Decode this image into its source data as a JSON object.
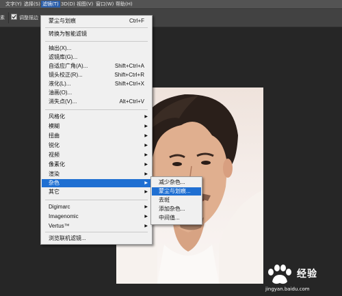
{
  "menubar": {
    "items": [
      {
        "label": "文字(Y)"
      },
      {
        "label": "选择(S)"
      },
      {
        "label": "滤镜(T)"
      },
      {
        "label": "3D(D)"
      },
      {
        "label": "视图(V)"
      },
      {
        "label": "窗口(W)"
      },
      {
        "label": "帮助(H)"
      }
    ]
  },
  "options_bar": {
    "left_fragment": "素",
    "checkbox_label": "调整描边",
    "checked": true
  },
  "filter_menu": {
    "items": [
      {
        "label": "蒙尘与划痕",
        "shortcut": "Ctrl+F"
      },
      {
        "label": "转换为智能滤镜"
      },
      {
        "label": "抽出(X)..."
      },
      {
        "label": "滤镜库(G)..."
      },
      {
        "label": "自适应广角(A)...",
        "shortcut": "Shift+Ctrl+A"
      },
      {
        "label": "镜头校正(R)...",
        "shortcut": "Shift+Ctrl+R"
      },
      {
        "label": "液化(L)...",
        "shortcut": "Shift+Ctrl+X"
      },
      {
        "label": "油画(O)..."
      },
      {
        "label": "消失点(V)...",
        "shortcut": "Alt+Ctrl+V"
      },
      {
        "label": "风格化"
      },
      {
        "label": "模糊"
      },
      {
        "label": "扭曲"
      },
      {
        "label": "锐化"
      },
      {
        "label": "视频"
      },
      {
        "label": "像素化"
      },
      {
        "label": "渲染"
      },
      {
        "label": "杂色"
      },
      {
        "label": "其它"
      },
      {
        "label": "Digimarc"
      },
      {
        "label": "Imagenomic"
      },
      {
        "label": "Vertus™"
      },
      {
        "label": "浏览联机滤镜..."
      }
    ]
  },
  "noise_submenu": {
    "items": [
      {
        "label": "减少杂色..."
      },
      {
        "label": "蒙尘与划痕..."
      },
      {
        "label": "去斑"
      },
      {
        "label": "添加杂色..."
      },
      {
        "label": "中间值..."
      }
    ]
  },
  "watermark": {
    "brand_text": "经验",
    "url": "jingyan.baidu.com"
  },
  "colors": {
    "highlight": "#1f6fd2",
    "menu_bg": "#f0f0f0",
    "app_bg": "#282828"
  }
}
